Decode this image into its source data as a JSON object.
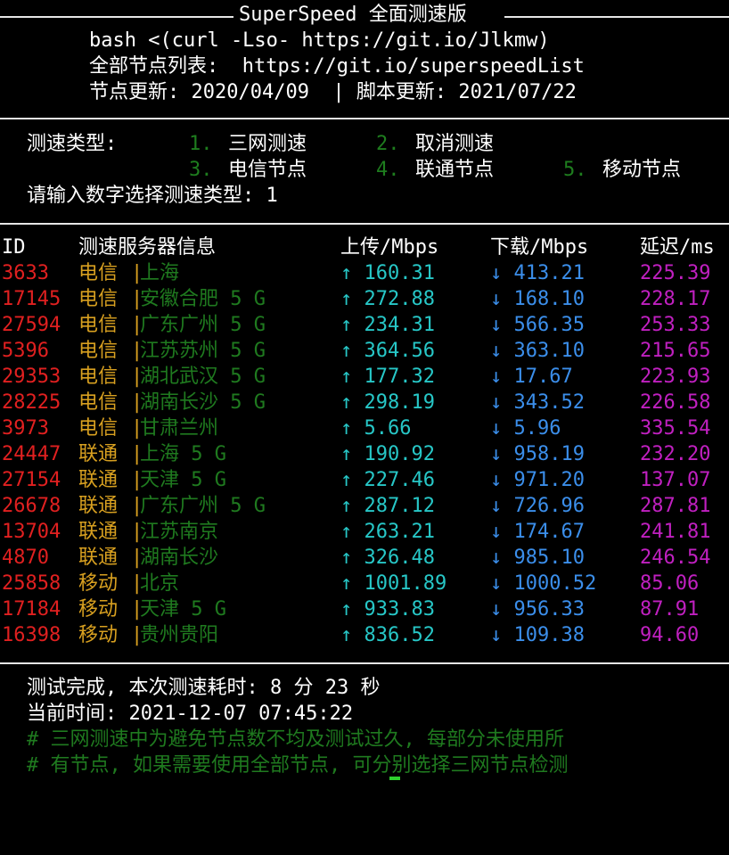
{
  "banner": {
    "title": "SuperSpeed 全面测速版",
    "command": "bash <(curl -Lso- https://git.io/Jlkmw)",
    "node_list": "全部节点列表:  https://git.io/superspeedList",
    "updates": "节点更新: 2020/04/09  | 脚本更新: 2021/07/22"
  },
  "menu": {
    "label": "测速类型:",
    "options": [
      {
        "num": "1.",
        "label": "三网测速"
      },
      {
        "num": "2.",
        "label": "取消测速"
      },
      {
        "num": "3.",
        "label": "电信节点"
      },
      {
        "num": "4.",
        "label": "联通节点"
      },
      {
        "num": "5.",
        "label": "移动节点"
      }
    ],
    "prompt": "请输入数字选择测速类型: 1"
  },
  "table": {
    "headers": {
      "id": "ID",
      "server": "测速服务器信息",
      "upload": "上传/Mbps",
      "download": "下载/Mbps",
      "latency": "延迟/ms"
    },
    "separator": "|",
    "rows": [
      {
        "id": "3633",
        "isp": "电信",
        "location": "上海",
        "upload": "↑ 160.31",
        "download": "↓ 413.21",
        "latency": "225.39"
      },
      {
        "id": "17145",
        "isp": "电信",
        "location": "安徽合肥 5 G",
        "upload": "↑ 272.88",
        "download": "↓ 168.10",
        "latency": "228.17"
      },
      {
        "id": "27594",
        "isp": "电信",
        "location": "广东广州 5 G",
        "upload": "↑ 234.31",
        "download": "↓ 566.35",
        "latency": "253.33"
      },
      {
        "id": "5396",
        "isp": "电信",
        "location": "江苏苏州 5 G",
        "upload": "↑ 364.56",
        "download": "↓ 363.10",
        "latency": "215.65"
      },
      {
        "id": "29353",
        "isp": "电信",
        "location": "湖北武汉 5 G",
        "upload": "↑ 177.32",
        "download": "↓ 17.67",
        "latency": "223.93"
      },
      {
        "id": "28225",
        "isp": "电信",
        "location": "湖南长沙 5 G",
        "upload": "↑ 298.19",
        "download": "↓ 343.52",
        "latency": "226.58"
      },
      {
        "id": "3973",
        "isp": "电信",
        "location": "甘肃兰州",
        "upload": "↑ 5.66",
        "download": "↓ 5.96",
        "latency": "335.54"
      },
      {
        "id": "24447",
        "isp": "联通",
        "location": "上海 5 G",
        "upload": "↑ 190.92",
        "download": "↓ 958.19",
        "latency": "232.20"
      },
      {
        "id": "27154",
        "isp": "联通",
        "location": "天津 5 G",
        "upload": "↑ 227.46",
        "download": "↓ 971.20",
        "latency": "137.07"
      },
      {
        "id": "26678",
        "isp": "联通",
        "location": "广东广州 5 G",
        "upload": "↑ 287.12",
        "download": "↓ 726.96",
        "latency": "287.81"
      },
      {
        "id": "13704",
        "isp": "联通",
        "location": "江苏南京",
        "upload": "↑ 263.21",
        "download": "↓ 174.67",
        "latency": "241.81"
      },
      {
        "id": "4870",
        "isp": "联通",
        "location": "湖南长沙",
        "upload": "↑ 326.48",
        "download": "↓ 985.10",
        "latency": "246.54"
      },
      {
        "id": "25858",
        "isp": "移动",
        "location": "北京",
        "upload": "↑ 1001.89",
        "download": "↓ 1000.52",
        "latency": "85.06"
      },
      {
        "id": "17184",
        "isp": "移动",
        "location": "天津 5 G",
        "upload": "↑ 933.83",
        "download": "↓ 956.33",
        "latency": "87.91"
      },
      {
        "id": "16398",
        "isp": "移动",
        "location": "贵州贵阳",
        "upload": "↑ 836.52",
        "download": "↓ 109.38",
        "latency": "94.60"
      }
    ]
  },
  "summary": {
    "duration": "测试完成, 本次测速耗时: 8 分 23 秒",
    "current_time": "当前时间: 2021-12-07 07:45:22",
    "note_1": "# 三网测速中为避免节点数不均及测试过久, 每部分未使用所",
    "note_2": "# 有节点, 如果需要使用全部节点, 可分别选择三网节点检测"
  },
  "colors": {
    "background": "#000000",
    "id": "#e02020",
    "isp": "#d8a020",
    "location": "#1f7a1f",
    "upload": "#27c7c7",
    "download": "#3b8eea",
    "latency": "#c020c0",
    "menu_number": "#1e7d1e",
    "cursor": "#2ed12e"
  }
}
